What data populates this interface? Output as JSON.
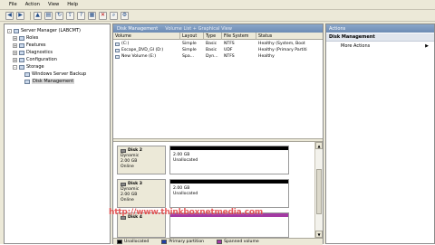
{
  "menu": [
    "File",
    "Action",
    "View",
    "Help"
  ],
  "toolbar": {
    "icons": [
      "back-icon",
      "forward-icon",
      "up-folder-icon",
      "show-tree-icon",
      "refresh-icon",
      "export-icon",
      "help-icon",
      "properties-icon",
      "delete-icon",
      "search-icon",
      "settings-icon"
    ]
  },
  "tree": {
    "items": [
      {
        "label": "Server Manager (LABCMT)",
        "level": 0,
        "expander": "-"
      },
      {
        "label": "Roles",
        "level": 1,
        "expander": "+"
      },
      {
        "label": "Features",
        "level": 1,
        "expander": "+"
      },
      {
        "label": "Diagnostics",
        "level": 1,
        "expander": "+"
      },
      {
        "label": "Configuration",
        "level": 1,
        "expander": "+"
      },
      {
        "label": "Storage",
        "level": 1,
        "expander": "-"
      },
      {
        "label": "Windows Server Backup",
        "level": 2,
        "expander": ""
      },
      {
        "label": "Disk Management",
        "level": 2,
        "expander": "",
        "selected": true
      }
    ]
  },
  "center": {
    "title": "Disk Management",
    "subtitle": "Volume List + Graphical View",
    "columns": [
      "Volume",
      "Layout",
      "Type",
      "File System",
      "Status"
    ],
    "rows": [
      [
        "(C:)",
        "Simple",
        "Basic",
        "NTFS",
        "Healthy (System, Boot"
      ],
      [
        "Escape_DVD_GI (D:)",
        "Simple",
        "Basic",
        "UDF",
        "Healthy (Primary Partiti"
      ],
      [
        "New Volume (E:)",
        "Spa...",
        "Dyn...",
        "NTFS",
        "Healthy"
      ]
    ],
    "disks": [
      {
        "name": "Disk 2",
        "type": "Dynamic",
        "size": "2.00 GB",
        "status": "Online",
        "part_size": "2.00 GB",
        "part_status": "Unallocated"
      },
      {
        "name": "Disk 3",
        "type": "Dynamic",
        "size": "2.00 GB",
        "status": "Online",
        "part_size": "2.00 GB",
        "part_status": "Unallocated"
      },
      {
        "name": "Disk 4",
        "type": "Dynamic",
        "size": "",
        "status": "",
        "part_size": "",
        "part_status": ""
      }
    ],
    "legend": [
      {
        "label": "Unallocated",
        "color": "#000000"
      },
      {
        "label": "Primary partition",
        "color": "#1f3fa8"
      },
      {
        "label": "Spanned volume",
        "color": "#a33aa3"
      }
    ]
  },
  "actions": {
    "title": "Actions",
    "section": "Disk Management",
    "item": "More Actions",
    "item_arrow": "▶"
  },
  "watermark": "http://www.thinkboxnetmedia.com"
}
